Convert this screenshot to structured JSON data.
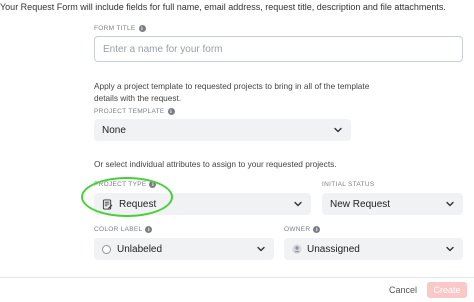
{
  "intro_text": "Your Request Form will include fields for full name, email address, request title, description and file attachments.",
  "form_title": {
    "label": "FORM TITLE",
    "placeholder": "Enter a name for your form",
    "value": ""
  },
  "template_description": "Apply a project template to requested projects to bring in all of the template details with the request.",
  "project_template": {
    "label": "PROJECT TEMPLATE",
    "value": "None"
  },
  "attributes_description": "Or select individual attributes to assign to your requested projects.",
  "project_type": {
    "label": "PROJECT TYPE",
    "value": "Request"
  },
  "initial_status": {
    "label": "INITIAL STATUS",
    "value": "New Request"
  },
  "color_label": {
    "label": "COLOR LABEL",
    "value": "Unlabeled"
  },
  "owner": {
    "label": "OWNER",
    "value": "Unassigned"
  },
  "footer": {
    "cancel_label": "Cancel",
    "create_label": "Create"
  },
  "colors": {
    "highlight_circle": "#46d037",
    "create_button_disabled": "#fbc8c8",
    "select_background": "#f1f2f4"
  },
  "icons": {
    "info": "info-icon",
    "chevron": "chevron-down-icon",
    "project_type": "request-form-icon",
    "color_label": "empty-circle-icon",
    "owner": "user-icon"
  }
}
